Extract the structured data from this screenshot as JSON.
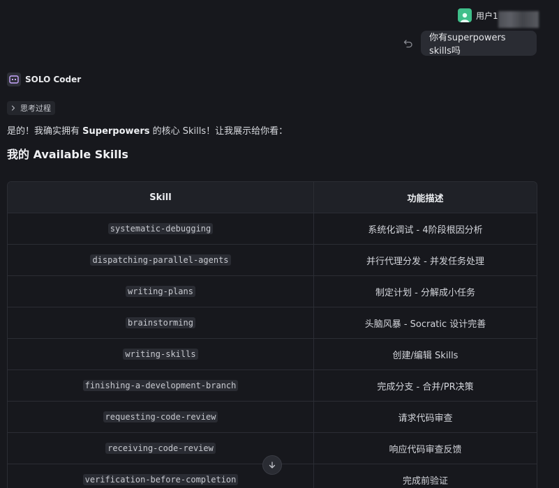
{
  "user": {
    "name": "用户1",
    "message": "你有superpowers skills吗"
  },
  "assistant": {
    "name": "SOLO Coder",
    "thinking_label": "思考过程",
    "intro_prefix": "是的！我确实拥有 ",
    "intro_bold": "Superpowers",
    "intro_suffix": " 的核心 Skills！让我展示给你看：",
    "heading": "我的 Available Skills"
  },
  "table": {
    "headers": [
      "Skill",
      "功能描述"
    ],
    "rows": [
      {
        "skill": "systematic-debugging",
        "desc": "系统化调试 - 4阶段根因分析"
      },
      {
        "skill": "dispatching-parallel-agents",
        "desc": "并行代理分发 - 并发任务处理"
      },
      {
        "skill": "writing-plans",
        "desc": "制定计划 - 分解成小任务"
      },
      {
        "skill": "brainstorming",
        "desc": "头脑风暴 - Socratic 设计完善"
      },
      {
        "skill": "writing-skills",
        "desc": "创建/编辑 Skills"
      },
      {
        "skill": "finishing-a-development-branch",
        "desc": "完成分支 - 合并/PR决策"
      },
      {
        "skill": "requesting-code-review",
        "desc": "请求代码审查"
      },
      {
        "skill": "receiving-code-review",
        "desc": "响应代码审查反馈"
      },
      {
        "skill": "verification-before-completion",
        "desc": "完成前验证"
      }
    ]
  },
  "icons": {
    "avatar": "user-avatar-icon",
    "undo": "undo-icon",
    "bot": "bot-icon",
    "chevron": "chevron-right-icon",
    "scroll": "arrow-down-icon"
  },
  "colors": {
    "background": "#17181d",
    "avatar": "#3fbf8a",
    "bubble": "#2a2c33"
  }
}
